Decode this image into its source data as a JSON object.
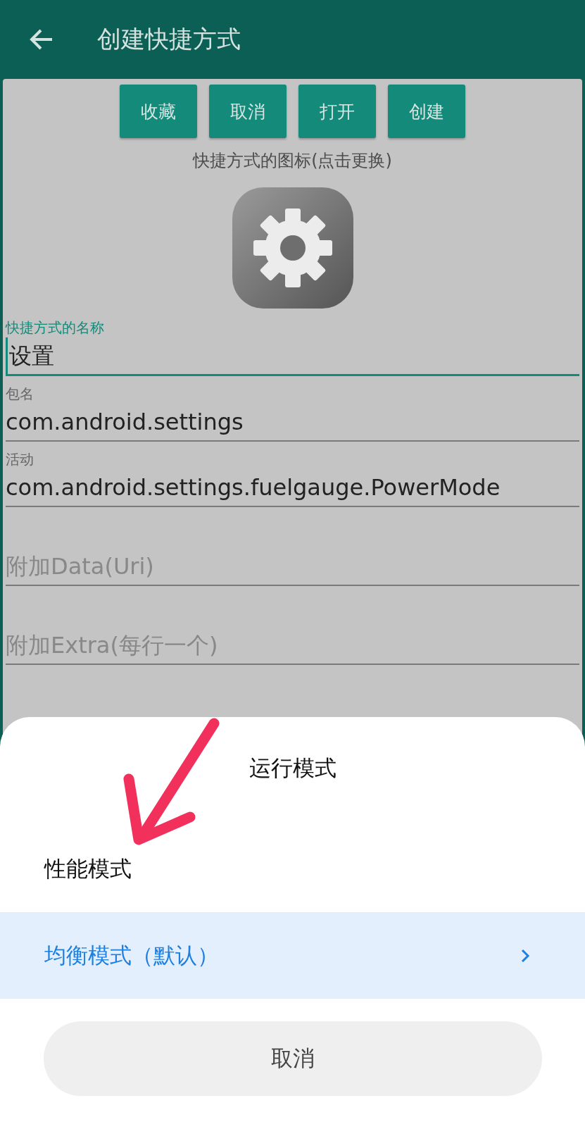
{
  "header": {
    "title": "创建快捷方式"
  },
  "actions": [
    "收藏",
    "取消",
    "打开",
    "创建"
  ],
  "icon_caption": "快捷方式的图标(点击更换)",
  "fields": [
    {
      "label": "快捷方式的名称",
      "value": "设置",
      "focused": true
    },
    {
      "label": "包名",
      "value": "com.android.settings",
      "focused": false
    },
    {
      "label": "活动",
      "value": "com.android.settings.fuelgauge.PowerMode",
      "focused": false
    },
    {
      "placeholder": "附加Data(Uri)",
      "focused": false
    },
    {
      "placeholder": "附加Extra(每行一个)",
      "focused": false
    }
  ],
  "sheet": {
    "title": "运行模式",
    "options": [
      {
        "label": "性能模式",
        "selected": false
      },
      {
        "label": "均衡模式（默认）",
        "selected": true
      }
    ],
    "cancel": "取消"
  }
}
